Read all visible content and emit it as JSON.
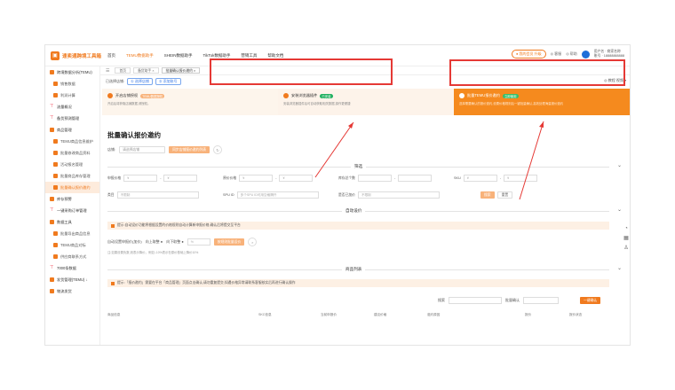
{
  "app": {
    "logo_text": "速卖通跨境工具箱",
    "brand_color": "#f07a1e"
  },
  "top_nav": [
    {
      "label": "首页"
    },
    {
      "label": "TEMU数据助手",
      "active": true
    },
    {
      "label": "SHEIN数据助手"
    },
    {
      "label": "TikTok数据助手"
    },
    {
      "label": "营销工具"
    },
    {
      "label": "帮助文档"
    }
  ],
  "top_right": {
    "member": "● 我的会员 升级",
    "service": "◎ 客服",
    "help": "◎ 帮助",
    "user_line1": "用户名 · 商家名称",
    "user_line2": "账号 · 18888888888"
  },
  "sidebar": [
    {
      "label": "跨境数据分析(TEMU)",
      "type": "group"
    },
    {
      "label": "销售数据",
      "type": "sub"
    },
    {
      "label": "利润计算",
      "type": "sub"
    },
    {
      "label": "流量概况",
      "type": "pin"
    },
    {
      "label": "备货预测管理",
      "type": "pin"
    },
    {
      "label": "商品管理",
      "type": "group"
    },
    {
      "label": "TEMU商品信息维护",
      "type": "sub"
    },
    {
      "label": "批量修改商品资料",
      "type": "sub"
    },
    {
      "label": "活动报名管理",
      "type": "sub"
    },
    {
      "label": "批量商品库存管理",
      "type": "sub"
    },
    {
      "label": "批量确认报价邀约",
      "type": "sub",
      "active": true
    },
    {
      "label": "库存预警",
      "type": "group"
    },
    {
      "label": "一键采购订单管理",
      "type": "pin"
    },
    {
      "label": "数据工具",
      "type": "group"
    },
    {
      "label": "批量导出商品信息",
      "type": "sub"
    },
    {
      "label": "TEMU商品对标",
      "type": "sub"
    },
    {
      "label": "供应商联系方式",
      "type": "sub"
    },
    {
      "label": "7000条数据",
      "type": "pin"
    },
    {
      "label": "发货管理(TEMU) ↓",
      "type": "group"
    },
    {
      "label": "物流发货",
      "type": "group"
    }
  ],
  "tabs": [
    {
      "label": "首页"
    },
    {
      "label": "备货助手 ×"
    },
    {
      "label": "批量确认报价邀约 ×",
      "on": true
    }
  ],
  "breadcrumb": {
    "prefix": "已选择店铺:",
    "pill1": "① 选择店铺",
    "pill2": "② 添加账号"
  },
  "right_links": "◎ 教程  视频 ▾",
  "steps": [
    {
      "title": "开启店铺授权",
      "tag": "TEMU数据授权",
      "desc": "开启后将获取店铺数据,请授权。"
    },
    {
      "title": "安装浏览器插件",
      "tag": "已安装",
      "desc": "安装浏览器插件后可自动获取相关数据,操作更便捷"
    },
    {
      "title": "批量TEMU报价邀约",
      "tag": "立即使用",
      "desc": "选择需要确认的报价邀约,设置价格规则后一键批量确认,高效处理海量报价邀约"
    }
  ],
  "page_title": "批量确认报价邀约",
  "store_row": {
    "label": "店铺:",
    "select": "请选择店铺",
    "btn": "同步店铺报价邀约列表",
    "refresh": "↻"
  },
  "filter_title": "筛选",
  "filters": {
    "r1": [
      {
        "label": "申报价格",
        "a": "¥",
        "b": "¥"
      },
      {
        "label": "原价价格",
        "a": "¥",
        "b": "¥"
      },
      {
        "label": "库存总个数",
        "a": "",
        "b": ""
      },
      {
        "label": "SKU",
        "a": "¥",
        "b": "¥"
      }
    ],
    "r2": [
      {
        "label": "类目",
        "value": "不限制"
      },
      {
        "label": "SPU ID",
        "value": "多个SPU ID可用空格隔开"
      },
      {
        "label": "是否已加价",
        "value": "不限制"
      }
    ],
    "search": "搜索",
    "reset": "重置"
  },
  "auto_title": "自动设价",
  "notice1": "提示:自动设价功能将根据设置的价格规则自动计算新申报价格,确认后将提交至平台",
  "auto_row": {
    "label": "自动设置申报价(加价)",
    "up": "向上取整 ●",
    "down": "向下取整 ●",
    "percent": "%",
    "btn": "按规则批量设价",
    "x": "×"
  },
  "auto_hint": "注:如果设置负数,则表示降价。例如:-10%表示在原价基础上降价10%",
  "list_title": "商品列表",
  "notice2": "提示:「报价邀约」需要在平台「商品管理」页面点击确认;请勿重复提交;如遇价格异常请联系客服核实后再进行确认操作",
  "list_search": {
    "label1": "搜索",
    "label2": "批量确认",
    "btn": "一键确认"
  },
  "table_headers": [
    "商品信息",
    "SKC信息",
    "当前申报价",
    "建议价格",
    "邀约原因",
    "报价",
    "报价状态"
  ]
}
